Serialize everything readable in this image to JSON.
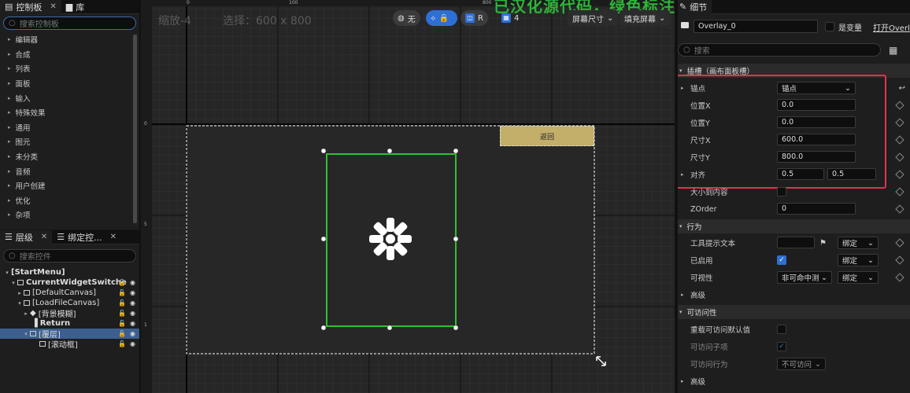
{
  "palette": {
    "tab_label": "控制板",
    "library_tab_label": "库",
    "search_placeholder": "搜索控制板",
    "categories": [
      "编辑器",
      "合成",
      "列表",
      "面板",
      "输入",
      "特殊效果",
      "通用",
      "图元",
      "未分类",
      "音频",
      "用户创建",
      "优化",
      "杂项"
    ]
  },
  "hierarchy": {
    "tab_label": "层级",
    "bind_tab_label": "绑定控...",
    "search_placeholder": "搜索控件",
    "rows": [
      {
        "label": "[StartMenu]"
      },
      {
        "label": "CurrentWidgetSwitche"
      },
      {
        "label": "[DefaultCanvas]"
      },
      {
        "label": "[LoadFileCanvas]"
      },
      {
        "label": "[背景模糊]"
      },
      {
        "label": "Return"
      },
      {
        "label": "[覆层]"
      },
      {
        "label": "[滚动框]"
      }
    ]
  },
  "designer": {
    "zoom_label": "缩放-4",
    "selection_label": "选择：600 x 800",
    "overlay_text": "已汉化源代码，绿色标注部分请删除！",
    "toolbar": {
      "none_label": "无",
      "r_label": "R",
      "grid_value": "4",
      "screen_size_label": "屏幕尺寸",
      "fill_screen_label": "填充屏幕"
    },
    "return_button_label": "返回",
    "ruler_top": [
      "0",
      "100",
      "800"
    ],
    "ruler_left": [
      "0",
      "5",
      "1"
    ]
  },
  "details": {
    "tab_label": "细节",
    "widget_name": "Overlay_0",
    "is_variable_label": "是变量",
    "open_label": "打开Overl",
    "search_placeholder": "搜索",
    "slot_section": "插槽（画布面板槽）",
    "anchor_label": "锚点",
    "anchor_value": "锚点",
    "pos_x_label": "位置X",
    "pos_x_value": "0.0",
    "pos_y_label": "位置Y",
    "pos_y_value": "0.0",
    "size_x_label": "尺寸X",
    "size_x_value": "600.0",
    "size_y_label": "尺寸Y",
    "size_y_value": "800.0",
    "align_label": "对齐",
    "align_x": "0.5",
    "align_y": "0.5",
    "size_to_content_label": "大小到内容",
    "zorder_label": "ZOrder",
    "zorder_value": "0",
    "behavior_section": "行为",
    "tooltip_label": "工具提示文本",
    "bind_label": "绑定",
    "enabled_label": "已启用",
    "visibility_label": "可视性",
    "visibility_value": "非可命中测",
    "advanced_label": "高级",
    "accessibility_section": "可访问性",
    "override_access_label": "重载可访问默认值",
    "access_children_label": "可访问子项",
    "access_behavior_label": "可访问行为",
    "access_behavior_value": "不可访问",
    "advanced2_label": "高级"
  },
  "colors": {
    "accent": "#2e6fd6",
    "highlight": "#e0334f",
    "selection": "#2ec22e",
    "button": "#c3ae6a"
  }
}
